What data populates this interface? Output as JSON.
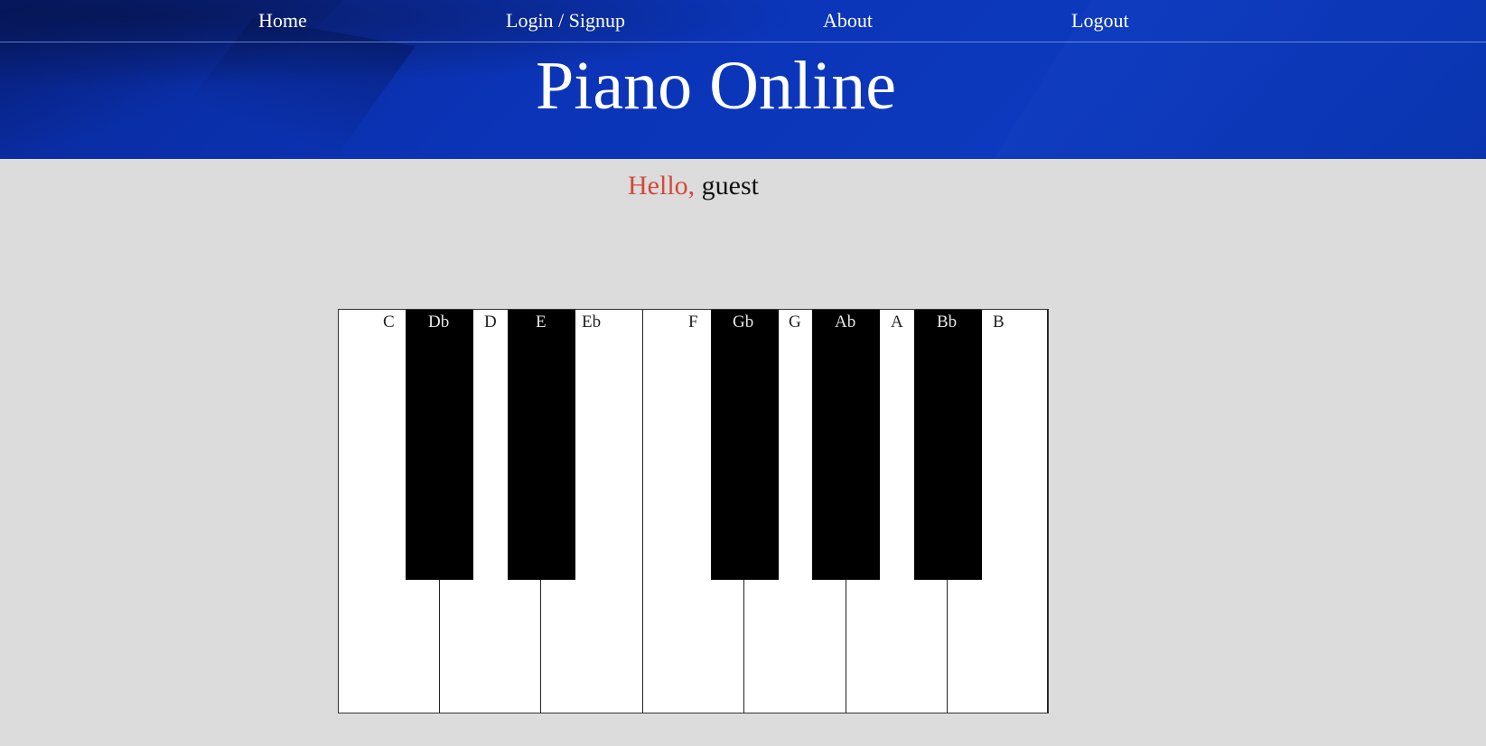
{
  "nav": {
    "items": [
      {
        "label": "Home"
      },
      {
        "label": "Login / Signup"
      },
      {
        "label": "About"
      },
      {
        "label": "Logout"
      }
    ]
  },
  "header": {
    "title": "Piano Online"
  },
  "greeting": {
    "hello": "Hello,",
    "user": "guest"
  },
  "piano": {
    "labels": {
      "C": "C",
      "Db": "Db",
      "D": "D",
      "E": "E",
      "Eb": "Eb",
      "F": "F",
      "Gb": "Gb",
      "G": "G",
      "Ab": "Ab",
      "A": "A",
      "Bb": "Bb",
      "B": "B"
    }
  },
  "colors": {
    "header_bg": "#0b34b8",
    "page_bg": "#dcdcdc",
    "hello": "#d04a3a"
  }
}
